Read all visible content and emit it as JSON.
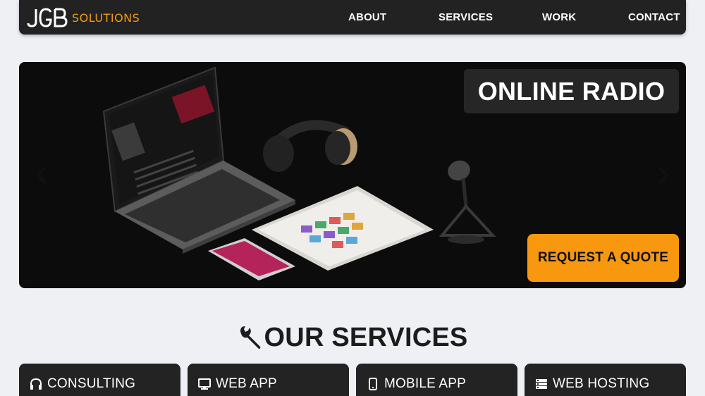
{
  "brand": {
    "logo_text": "JGB",
    "word": "SOLUTIONS",
    "accent": "#f39a13"
  },
  "nav": {
    "items": [
      {
        "label": "ABOUT"
      },
      {
        "label": "SERVICES"
      },
      {
        "label": "WORK"
      },
      {
        "label": "CONTACT"
      }
    ]
  },
  "hero": {
    "title": "ONLINE RADIO",
    "cta": "REQUEST A QUOTE",
    "prev_icon": "chevron-left-icon",
    "next_icon": "chevron-right-icon",
    "cta_color": "#f7980f"
  },
  "services": {
    "heading": "OUR SERVICES",
    "heading_icon": "wrench-icon",
    "cards": [
      {
        "label": "CONSULTING",
        "icon": "headphones-icon"
      },
      {
        "label": "WEB APP",
        "icon": "desktop-icon"
      },
      {
        "label": "MOBILE APP",
        "icon": "mobile-icon"
      },
      {
        "label": "WEB HOSTING",
        "icon": "server-icon"
      }
    ]
  }
}
